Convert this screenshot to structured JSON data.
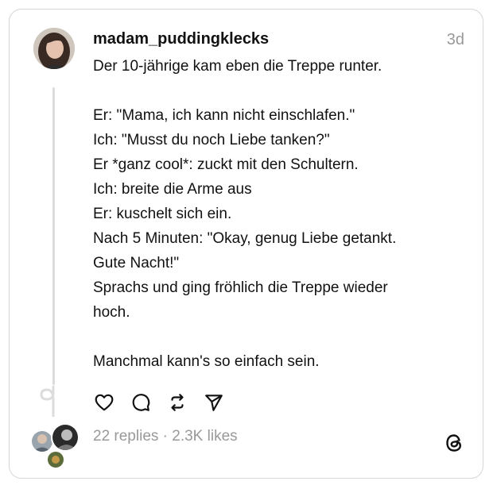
{
  "post": {
    "username": "madam_puddingklecks",
    "timestamp": "3d",
    "lines": [
      "Der 10-jährige kam eben die Treppe runter.",
      "",
      "Er: \"Mama, ich kann nicht einschlafen.\"",
      "Ich: \"Musst du noch Liebe tanken?\"",
      "Er *ganz cool*: zuckt mit den Schultern.",
      "Ich: breite die Arme aus",
      "Er: kuschelt sich ein.",
      "Nach 5 Minuten: \"Okay, genug Liebe getankt.",
      "Gute Nacht!\"",
      "Sprachs und ging fröhlich die Treppe wieder",
      "hoch.",
      "",
      "Manchmal kann's so einfach sein."
    ],
    "stats": "22 replies · 2.3K likes"
  },
  "actions": [
    {
      "name": "like-button",
      "icon": "heart-icon"
    },
    {
      "name": "reply-button",
      "icon": "comment-icon"
    },
    {
      "name": "repost-button",
      "icon": "repost-icon"
    },
    {
      "name": "share-button",
      "icon": "send-icon"
    }
  ],
  "colors": {
    "text": "#111111",
    "muted": "#999999",
    "border": "#d6d6d6",
    "thread_line": "#dcdcdc"
  }
}
